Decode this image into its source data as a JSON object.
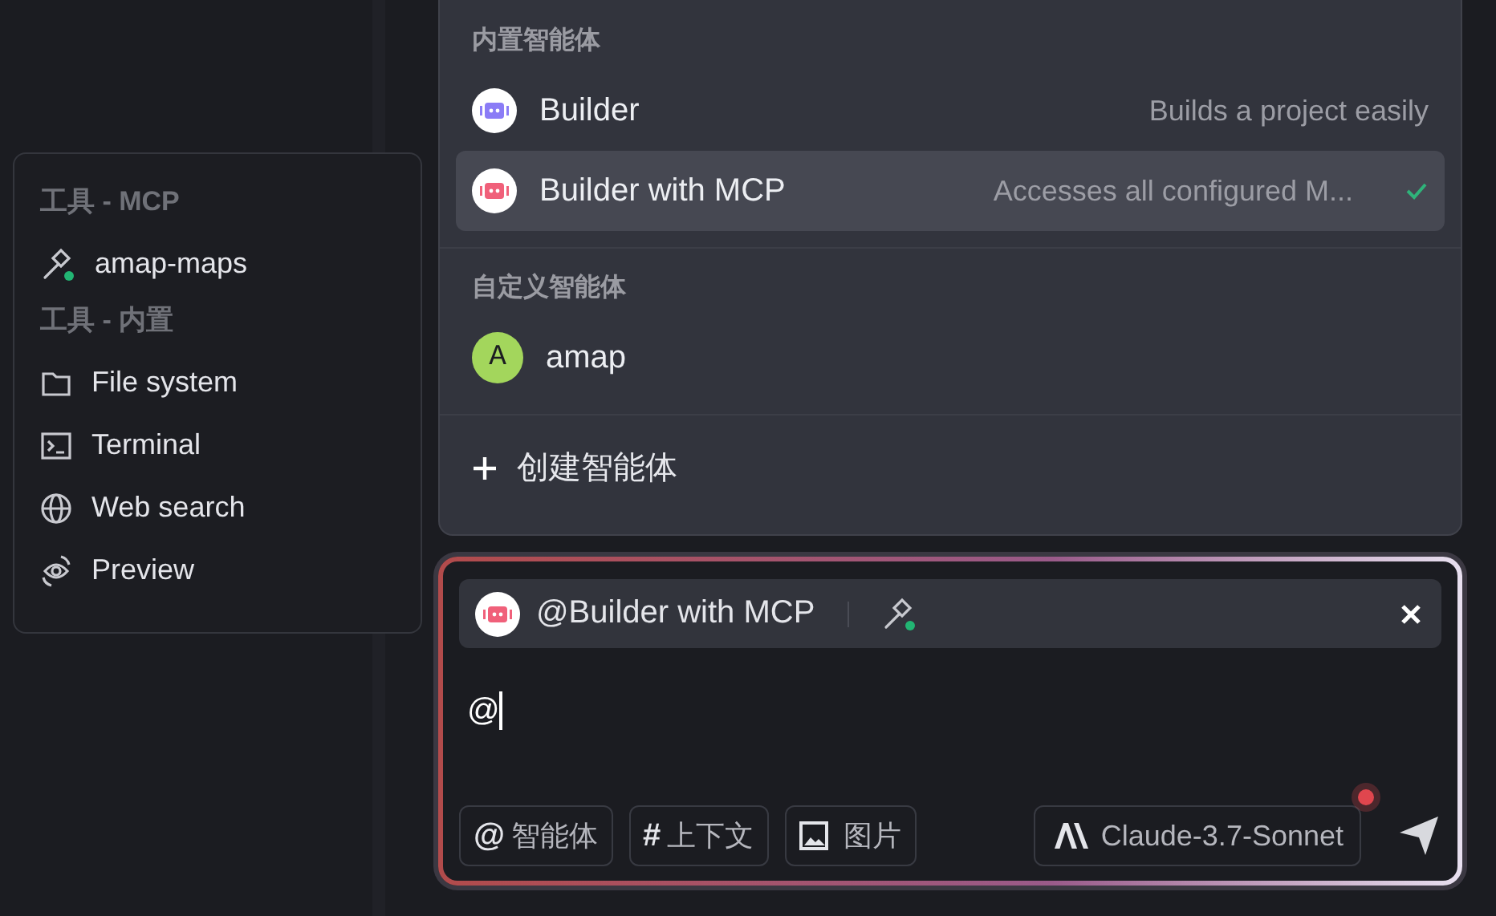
{
  "tools_popup": {
    "sections": [
      {
        "title": "工具 - MCP",
        "items": [
          {
            "label": "amap-maps",
            "online": true
          }
        ]
      },
      {
        "title": "工具 - 内置",
        "items": [
          {
            "label": "File system"
          },
          {
            "label": "Terminal"
          },
          {
            "label": "Web search"
          },
          {
            "label": "Preview"
          }
        ]
      }
    ]
  },
  "agent_menu": {
    "sections": [
      {
        "title": "内置智能体",
        "items": [
          {
            "name": "Builder",
            "description": "Builds a project easily",
            "kind": "bot",
            "color": "#8b7cf6",
            "selected": false
          },
          {
            "name": "Builder with MCP",
            "description": "Accesses all configured M...",
            "kind": "bot",
            "color": "#f0607a",
            "selected": true
          }
        ]
      },
      {
        "title": "自定义智能体",
        "items": [
          {
            "name": "amap",
            "kind": "letter",
            "letter": "A",
            "color": "#a3d65c",
            "selected": false
          }
        ]
      }
    ],
    "create_label": "创建智能体"
  },
  "composer": {
    "chip": {
      "label": "@Builder with MCP",
      "color": "#f0607a",
      "tools_online": true
    },
    "value": "@",
    "buttons": [
      {
        "kind": "char",
        "icon": "@",
        "label": "智能体"
      },
      {
        "kind": "char",
        "icon": "#",
        "label": "上下文"
      },
      {
        "kind": "image",
        "label": "图片"
      }
    ],
    "model": {
      "label": "Claude-3.7-Sonnet",
      "notification": true
    }
  }
}
